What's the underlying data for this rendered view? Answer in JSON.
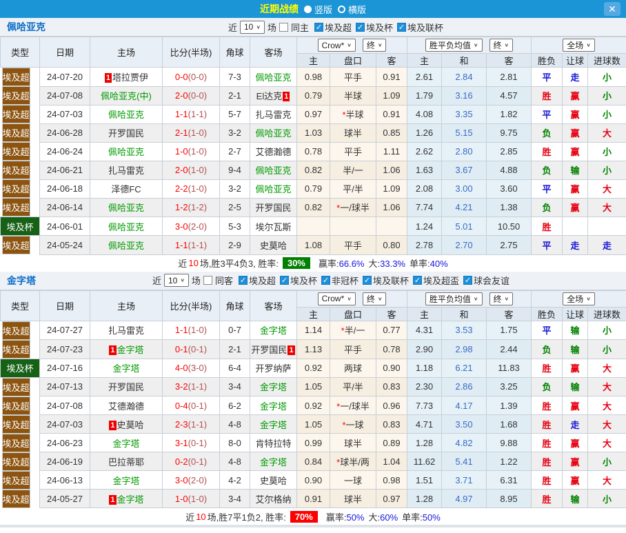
{
  "titlebar": {
    "title": "近期战绩",
    "radios": [
      {
        "label": "竖版",
        "selected": true
      },
      {
        "label": "横版",
        "selected": false
      }
    ]
  },
  "icons": {
    "close": "✕",
    "chevron": "∨",
    "check": "✓"
  },
  "controls": {
    "odds_source": "Crow*",
    "final_a": "终",
    "avg_label": "胜平负均值",
    "final_b": "终",
    "scope": "全场"
  },
  "columns": {
    "type": "类型",
    "date": "日期",
    "home": "主场",
    "score": "比分(半场)",
    "corner": "角球",
    "away": "客场",
    "odds_home": "主",
    "handicap": "盘口",
    "odds_away": "客",
    "avg_home": "主",
    "avg_draw": "和",
    "avg_away": "客",
    "result": "胜负",
    "handicap_result": "让球",
    "goals": "进球数"
  },
  "sections": [
    {
      "team": "佩哈亚克",
      "filters": {
        "near": "近",
        "count": "10",
        "games": "场",
        "same": "同主",
        "same_checked": false,
        "leagues": [
          "埃及超",
          "埃及杯",
          "埃及联杯"
        ]
      },
      "rows": [
        {
          "type": "埃及超",
          "date": "24-07-20",
          "home": "塔拉贾伊",
          "home_focus": false,
          "home_badge": "1",
          "score_ft": "0-0",
          "score_ht": "(0-0)",
          "corner": "7-3",
          "away": "佩哈亚克",
          "away_focus": true,
          "away_badge": "",
          "odds_home": "0.98",
          "handicap": "平手",
          "odds_away": "0.91",
          "avg_home": "2.61",
          "avg_draw": "2.84",
          "avg_away": "2.81",
          "result": "平",
          "let_result": "走",
          "goals": "小"
        },
        {
          "type": "埃及超",
          "date": "24-07-08",
          "home": "佩哈亚克(中)",
          "home_focus": true,
          "home_badge": "",
          "score_ft": "2-0",
          "score_ht": "(0-0)",
          "corner": "2-1",
          "away": "El达克",
          "away_focus": false,
          "away_badge": "1",
          "odds_home": "0.79",
          "handicap": "半球",
          "odds_away": "1.09",
          "avg_home": "1.79",
          "avg_draw": "3.16",
          "avg_away": "4.57",
          "result": "胜",
          "let_result": "赢",
          "goals": "小"
        },
        {
          "type": "埃及超",
          "date": "24-07-03",
          "home": "佩哈亚克",
          "home_focus": true,
          "home_badge": "",
          "score_ft": "1-1",
          "score_ht": "(1-1)",
          "corner": "5-7",
          "away": "扎马雷克",
          "away_focus": false,
          "away_badge": "",
          "odds_home": "0.97",
          "handicap": "*半球",
          "odds_away": "0.91",
          "avg_home": "4.08",
          "avg_draw": "3.35",
          "avg_away": "1.82",
          "result": "平",
          "let_result": "赢",
          "goals": "小"
        },
        {
          "type": "埃及超",
          "date": "24-06-28",
          "home": "开罗国民",
          "home_focus": false,
          "home_badge": "",
          "score_ft": "2-1",
          "score_ht": "(1-0)",
          "corner": "3-2",
          "away": "佩哈亚克",
          "away_focus": true,
          "away_badge": "",
          "odds_home": "1.03",
          "handicap": "球半",
          "odds_away": "0.85",
          "avg_home": "1.26",
          "avg_draw": "5.15",
          "avg_away": "9.75",
          "result": "负",
          "let_result": "赢",
          "goals": "大"
        },
        {
          "type": "埃及超",
          "date": "24-06-24",
          "home": "佩哈亚克",
          "home_focus": true,
          "home_badge": "",
          "score_ft": "1-0",
          "score_ht": "(1-0)",
          "corner": "2-7",
          "away": "艾德瀚德",
          "away_focus": false,
          "away_badge": "",
          "odds_home": "0.78",
          "handicap": "平手",
          "odds_away": "1.11",
          "avg_home": "2.62",
          "avg_draw": "2.80",
          "avg_away": "2.85",
          "result": "胜",
          "let_result": "赢",
          "goals": "小"
        },
        {
          "type": "埃及超",
          "date": "24-06-21",
          "home": "扎马雷克",
          "home_focus": false,
          "home_badge": "",
          "score_ft": "2-0",
          "score_ht": "(1-0)",
          "corner": "9-4",
          "away": "佩哈亚克",
          "away_focus": true,
          "away_badge": "",
          "odds_home": "0.82",
          "handicap": "半/一",
          "odds_away": "1.06",
          "avg_home": "1.63",
          "avg_draw": "3.67",
          "avg_away": "4.88",
          "result": "负",
          "let_result": "输",
          "goals": "小"
        },
        {
          "type": "埃及超",
          "date": "24-06-18",
          "home": "泽德FC",
          "home_focus": false,
          "home_badge": "",
          "score_ft": "2-2",
          "score_ht": "(1-0)",
          "corner": "3-2",
          "away": "佩哈亚克",
          "away_focus": true,
          "away_badge": "",
          "odds_home": "0.79",
          "handicap": "平/半",
          "odds_away": "1.09",
          "avg_home": "2.08",
          "avg_draw": "3.00",
          "avg_away": "3.60",
          "result": "平",
          "let_result": "赢",
          "goals": "大"
        },
        {
          "type": "埃及超",
          "date": "24-06-14",
          "home": "佩哈亚克",
          "home_focus": true,
          "home_badge": "",
          "score_ft": "1-2",
          "score_ht": "(1-2)",
          "corner": "2-5",
          "away": "开罗国民",
          "away_focus": false,
          "away_badge": "",
          "odds_home": "0.82",
          "handicap": "*一/球半",
          "odds_away": "1.06",
          "avg_home": "7.74",
          "avg_draw": "4.21",
          "avg_away": "1.38",
          "result": "负",
          "let_result": "赢",
          "goals": "大"
        },
        {
          "type": "埃及杯",
          "date": "24-06-01",
          "home": "佩哈亚克",
          "home_focus": true,
          "home_badge": "",
          "score_ft": "3-0",
          "score_ht": "(2-0)",
          "corner": "5-3",
          "away": "埃尔瓦斯",
          "away_focus": false,
          "away_badge": "",
          "odds_home": "",
          "handicap": "",
          "odds_away": "",
          "avg_home": "1.24",
          "avg_draw": "5.01",
          "avg_away": "10.50",
          "result": "胜",
          "let_result": "",
          "goals": ""
        },
        {
          "type": "埃及超",
          "date": "24-05-24",
          "home": "佩哈亚克",
          "home_focus": true,
          "home_badge": "",
          "score_ft": "1-1",
          "score_ht": "(1-1)",
          "corner": "2-9",
          "away": "史莫哈",
          "away_focus": false,
          "away_badge": "",
          "odds_home": "1.08",
          "handicap": "平手",
          "odds_away": "0.80",
          "avg_home": "2.78",
          "avg_draw": "2.70",
          "avg_away": "2.75",
          "result": "平",
          "let_result": "走",
          "goals": "走"
        }
      ],
      "summary": {
        "lead": "近",
        "count": "10",
        "text": "场,胜3平4负3, 胜率:",
        "rate": "30%",
        "rate_color": "#008000",
        "stats": [
          {
            "label": "赢率:",
            "value": "66.6%"
          },
          {
            "label": "大:",
            "value": "33.3%"
          },
          {
            "label": "单率:",
            "value": "40%"
          }
        ]
      }
    },
    {
      "team": "金字塔",
      "filters": {
        "near": "近",
        "count": "10",
        "games": "场",
        "same": "同客",
        "same_checked": false,
        "leagues": [
          "埃及超",
          "埃及杯",
          "非冠杯",
          "埃及联杯",
          "埃及超盃",
          "球会友谊"
        ]
      },
      "rows": [
        {
          "type": "埃及超",
          "date": "24-07-27",
          "home": "扎马雷克",
          "home_focus": false,
          "home_badge": "",
          "score_ft": "1-1",
          "score_ht": "(1-0)",
          "corner": "0-7",
          "away": "金字塔",
          "away_focus": true,
          "away_badge": "",
          "odds_home": "1.14",
          "handicap": "*半/一",
          "odds_away": "0.77",
          "avg_home": "4.31",
          "avg_draw": "3.53",
          "avg_away": "1.75",
          "result": "平",
          "let_result": "输",
          "goals": "小"
        },
        {
          "type": "埃及超",
          "date": "24-07-23",
          "home": "金字塔",
          "home_focus": true,
          "home_badge": "1",
          "score_ft": "0-1",
          "score_ht": "(0-1)",
          "corner": "2-1",
          "away": "开罗国民",
          "away_focus": false,
          "away_badge": "1",
          "odds_home": "1.13",
          "handicap": "平手",
          "odds_away": "0.78",
          "avg_home": "2.90",
          "avg_draw": "2.98",
          "avg_away": "2.44",
          "result": "负",
          "let_result": "输",
          "goals": "小"
        },
        {
          "type": "埃及杯",
          "date": "24-07-16",
          "home": "金字塔",
          "home_focus": true,
          "home_badge": "",
          "score_ft": "4-0",
          "score_ht": "(3-0)",
          "corner": "6-4",
          "away": "开罗纳萨",
          "away_focus": false,
          "away_badge": "",
          "odds_home": "0.92",
          "handicap": "两球",
          "odds_away": "0.90",
          "avg_home": "1.18",
          "avg_draw": "6.21",
          "avg_away": "11.83",
          "result": "胜",
          "let_result": "赢",
          "goals": "大"
        },
        {
          "type": "埃及超",
          "date": "24-07-13",
          "home": "开罗国民",
          "home_focus": false,
          "home_badge": "",
          "score_ft": "3-2",
          "score_ht": "(1-1)",
          "corner": "3-4",
          "away": "金字塔",
          "away_focus": true,
          "away_badge": "",
          "odds_home": "1.05",
          "handicap": "平/半",
          "odds_away": "0.83",
          "avg_home": "2.30",
          "avg_draw": "2.86",
          "avg_away": "3.25",
          "result": "负",
          "let_result": "输",
          "goals": "大"
        },
        {
          "type": "埃及超",
          "date": "24-07-08",
          "home": "艾德瀚德",
          "home_focus": false,
          "home_badge": "",
          "score_ft": "0-4",
          "score_ht": "(0-1)",
          "corner": "6-2",
          "away": "金字塔",
          "away_focus": true,
          "away_badge": "",
          "odds_home": "0.92",
          "handicap": "*一/球半",
          "odds_away": "0.96",
          "avg_home": "7.73",
          "avg_draw": "4.17",
          "avg_away": "1.39",
          "result": "胜",
          "let_result": "赢",
          "goals": "大"
        },
        {
          "type": "埃及超",
          "date": "24-07-03",
          "home": "史莫哈",
          "home_focus": false,
          "home_badge": "1",
          "score_ft": "2-3",
          "score_ht": "(1-1)",
          "corner": "4-8",
          "away": "金字塔",
          "away_focus": true,
          "away_badge": "",
          "odds_home": "1.05",
          "handicap": "*一球",
          "odds_away": "0.83",
          "avg_home": "4.71",
          "avg_draw": "3.50",
          "avg_away": "1.68",
          "result": "胜",
          "let_result": "走",
          "goals": "大"
        },
        {
          "type": "埃及超",
          "date": "24-06-23",
          "home": "金字塔",
          "home_focus": true,
          "home_badge": "",
          "score_ft": "3-1",
          "score_ht": "(0-1)",
          "corner": "8-0",
          "away": "肯特拉特",
          "away_focus": false,
          "away_badge": "",
          "odds_home": "0.99",
          "handicap": "球半",
          "odds_away": "0.89",
          "avg_home": "1.28",
          "avg_draw": "4.82",
          "avg_away": "9.88",
          "result": "胜",
          "let_result": "赢",
          "goals": "大"
        },
        {
          "type": "埃及超",
          "date": "24-06-19",
          "home": "巴拉蒂耶",
          "home_focus": false,
          "home_badge": "",
          "score_ft": "0-2",
          "score_ht": "(0-1)",
          "corner": "4-8",
          "away": "金字塔",
          "away_focus": true,
          "away_badge": "",
          "odds_home": "0.84",
          "handicap": "*球半/两",
          "odds_away": "1.04",
          "avg_home": "11.62",
          "avg_draw": "5.41",
          "avg_away": "1.22",
          "result": "胜",
          "let_result": "赢",
          "goals": "小"
        },
        {
          "type": "埃及超",
          "date": "24-06-13",
          "home": "金字塔",
          "home_focus": true,
          "home_badge": "",
          "score_ft": "3-0",
          "score_ht": "(2-0)",
          "corner": "4-2",
          "away": "史莫哈",
          "away_focus": false,
          "away_badge": "",
          "odds_home": "0.90",
          "handicap": "一球",
          "odds_away": "0.98",
          "avg_home": "1.51",
          "avg_draw": "3.71",
          "avg_away": "6.31",
          "result": "胜",
          "let_result": "赢",
          "goals": "大"
        },
        {
          "type": "埃及超",
          "date": "24-05-27",
          "home": "金字塔",
          "home_focus": true,
          "home_badge": "1",
          "score_ft": "1-0",
          "score_ht": "(1-0)",
          "corner": "3-4",
          "away": "艾尔格纳",
          "away_focus": false,
          "away_badge": "",
          "odds_home": "0.91",
          "handicap": "球半",
          "odds_away": "0.97",
          "avg_home": "1.28",
          "avg_draw": "4.97",
          "avg_away": "8.95",
          "result": "胜",
          "let_result": "输",
          "goals": "小"
        }
      ],
      "summary": {
        "lead": "近",
        "count": "10",
        "text": "场,胜7平1负2, 胜率:",
        "rate": "70%",
        "rate_color": "#ff0000",
        "stats": [
          {
            "label": "赢率:",
            "value": "50%"
          },
          {
            "label": "大:",
            "value": "60%"
          },
          {
            "label": "单率:",
            "value": "50%"
          }
        ]
      }
    }
  ]
}
